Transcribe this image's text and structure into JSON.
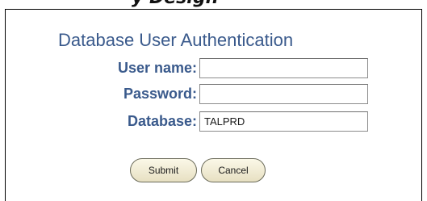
{
  "header_fragment": "y Design",
  "form": {
    "title": "Database User Authentication",
    "fields": {
      "username": {
        "label": "User name:",
        "value": ""
      },
      "password": {
        "label": "Password:",
        "value": ""
      },
      "database": {
        "label": "Database:",
        "value": "TALPRD"
      }
    },
    "buttons": {
      "submit": "Submit",
      "cancel": "Cancel"
    }
  }
}
